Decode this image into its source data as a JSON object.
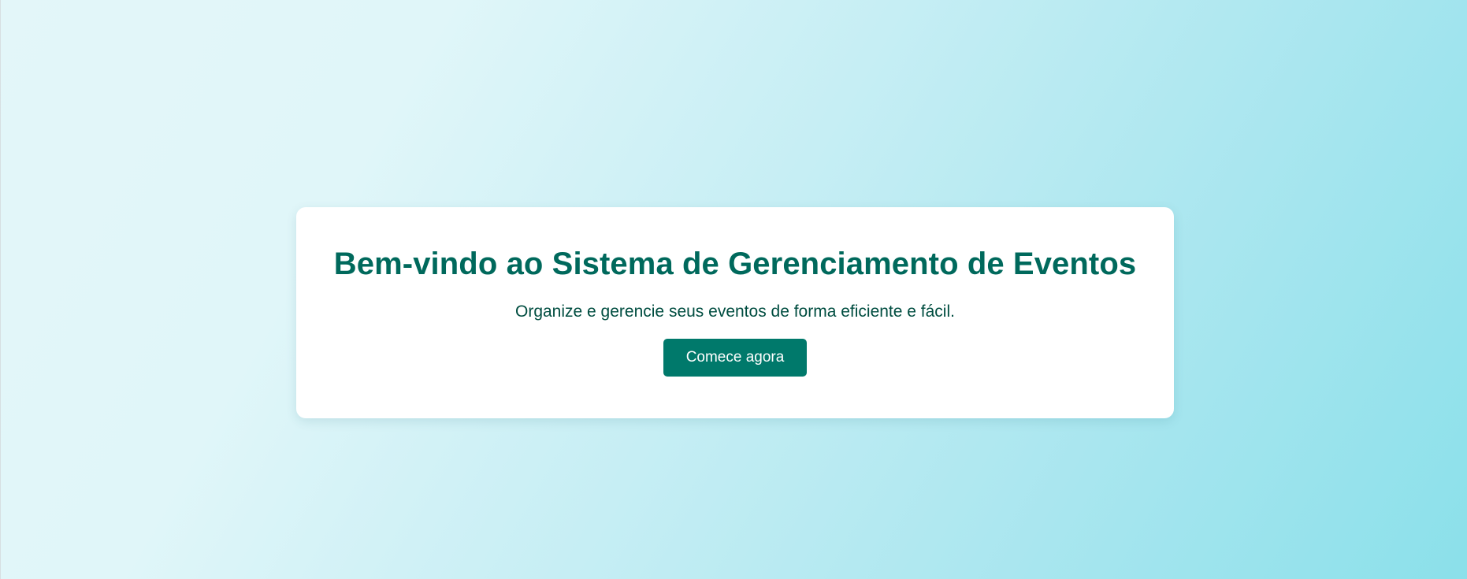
{
  "hero": {
    "title": "Bem-vindo ao Sistema de Gerenciamento de Eventos",
    "subtitle": "Organize e gerencie seus eventos de forma eficiente e fácil.",
    "cta_label": "Comece agora"
  },
  "colors": {
    "title": "#00695c",
    "subtitle": "#004d40",
    "button_bg": "#00796b",
    "button_text": "#ffffff",
    "card_bg": "#ffffff",
    "background_start": "#e3f6f9",
    "background_end": "#8be0ea"
  }
}
